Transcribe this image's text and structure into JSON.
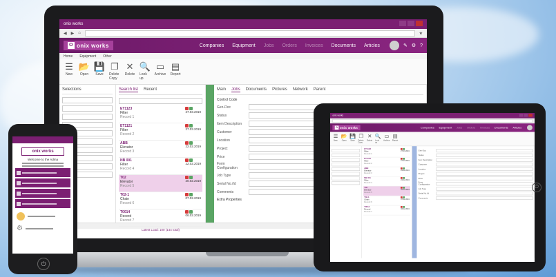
{
  "laptop": {
    "app_name": "onix works",
    "logo_letter": "O",
    "nav": [
      "Companies",
      "Equipment",
      "Jobs",
      "Orders",
      "Invoices",
      "Documents",
      "Articles"
    ],
    "nav_dim": [
      false,
      false,
      true,
      true,
      true,
      false,
      false
    ],
    "ribbon_tabs": [
      "Home",
      "Equipment",
      "Other"
    ],
    "ribbon_buttons": [
      {
        "label": "New",
        "icon": "☰"
      },
      {
        "label": "Open",
        "icon": "📂"
      },
      {
        "label": "Save",
        "icon": "💾"
      },
      {
        "label": "Delete Copy",
        "icon": "❐"
      },
      {
        "label": "Delete",
        "icon": "✕"
      },
      {
        "label": "Look up",
        "icon": "🔍"
      },
      {
        "label": "Archive",
        "icon": "▭"
      },
      {
        "label": "Report",
        "icon": "▤"
      }
    ],
    "selections_header": "Selections",
    "search_tabs": [
      "Search list",
      "Recent"
    ],
    "detail_tabs": [
      "Main",
      "Jobs",
      "Documents",
      "Pictures",
      "Network",
      "Parent"
    ],
    "list_items": [
      {
        "id": "ET1123",
        "line1": "Filter",
        "line2": "Record 1",
        "date": "27.03.2019",
        "sel": false
      },
      {
        "id": "ET1121",
        "line1": "Filter",
        "line2": "Record 2",
        "date": "27.03.2019",
        "sel": false
      },
      {
        "id": "ABB",
        "line1": "Elevator",
        "line2": "Record 3",
        "date": "22.02.2019",
        "sel": false
      },
      {
        "id": "NB 001",
        "line1": "Filter",
        "line2": "Record 4",
        "date": "22.02.2019",
        "sel": false
      },
      {
        "id": "T02",
        "line1": "Elevator",
        "line2": "Record 5",
        "date": "20.02.2019",
        "sel": true
      },
      {
        "id": "T02-1",
        "line1": "Chain",
        "line2": "Record 6",
        "date": "07.02.2019",
        "sel": false
      },
      {
        "id": "T0014",
        "line1": "Record",
        "line2": "Record 7",
        "date": "06.02.2019",
        "sel": false
      }
    ],
    "list_footer": "Latest Load: 100 (144 total)",
    "form_rows": [
      "Gen-Doc",
      "Status",
      "Item Description",
      "Customer",
      "Location",
      "Project",
      "Price",
      "Form Configuration",
      "Job Type",
      "Serial No./Id",
      "Comments"
    ],
    "section_title": "Control Code",
    "section2_title": "Extra Properties"
  },
  "phone": {
    "logo_text": "onix works",
    "welcome": "Welcome to the Adma",
    "cards": 4
  },
  "colors": {
    "brand": "#7b1f72",
    "accent": "#a6409b",
    "green": "#5aa564",
    "red": "#d63b3b"
  }
}
